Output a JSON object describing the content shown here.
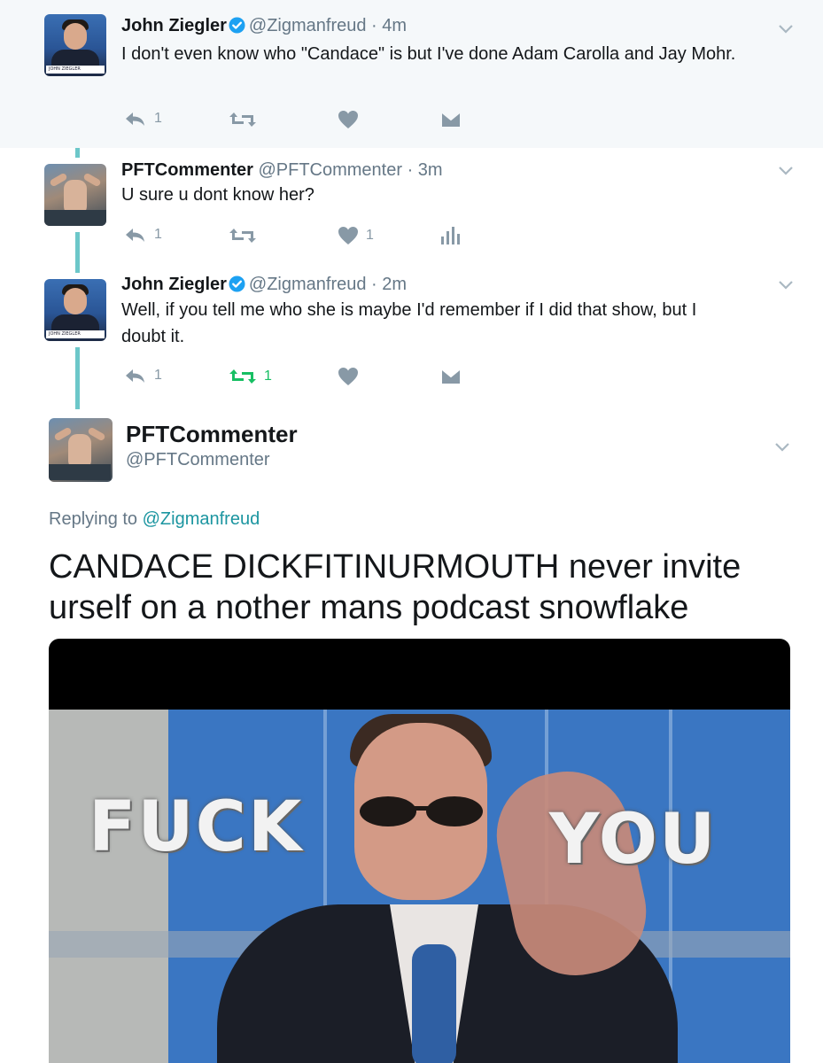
{
  "thread": [
    {
      "name": "John Ziegler",
      "verified": true,
      "handle": "@Zigmanfreud",
      "time": "· 4m",
      "text": "I don't even know who \"Candace\" is but I've done Adam Carolla and Jay Mohr.",
      "actions": {
        "replies": "1",
        "retweets": "",
        "likes": "",
        "last_icon": "dm-icon"
      },
      "highlighted": true
    },
    {
      "name": "PFTCommenter",
      "verified": false,
      "handle": "@PFTCommenter",
      "time": "· 3m",
      "text": "U sure u dont know her?",
      "actions": {
        "replies": "1",
        "retweets": "",
        "likes": "1",
        "last_icon": "analytics-icon"
      },
      "highlighted": false
    },
    {
      "name": "John Ziegler",
      "verified": true,
      "handle": "@Zigmanfreud",
      "time": "· 2m",
      "text": "Well, if you tell me who she is maybe I'd remember if I did that show, but I doubt it.",
      "actions": {
        "replies": "1",
        "retweets": "1",
        "likes": "",
        "last_icon": "dm-icon",
        "retweeted": true
      },
      "highlighted": false
    }
  ],
  "main_tweet": {
    "name": "PFTCommenter",
    "handle": "@PFTCommenter",
    "replying_prefix": "Replying to",
    "replying_to": "@Zigmanfreud",
    "text": "CANDACE DICKFITINURMOUTH never invite urself on a nother mans podcast snowflake",
    "media": {
      "caption_left": "FUCK",
      "caption_right": "YOU"
    }
  },
  "avatar_badge_text": "JOHN ZIEGLER",
  "colors": {
    "thread_line": "#6cc7c9",
    "verified_blue": "#1da1f2",
    "retweet_green": "#17bf63",
    "link": "#1b95a0",
    "muted": "#8899a6"
  }
}
